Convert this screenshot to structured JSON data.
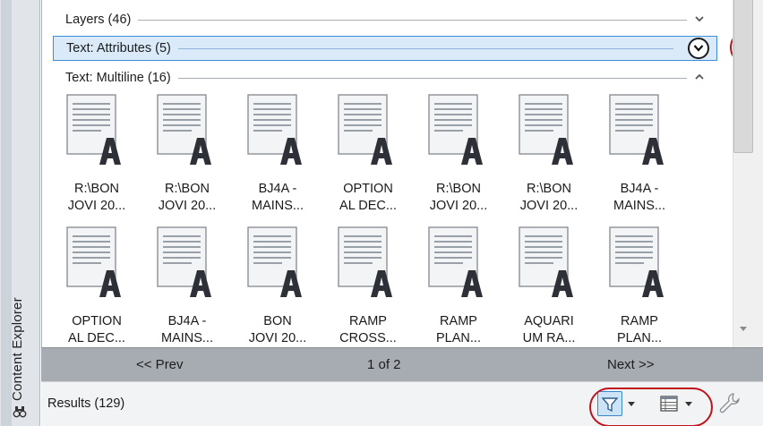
{
  "sidebar": {
    "title": "Content Explorer",
    "icon": "binoculars-icon"
  },
  "categories": [
    {
      "label": "Layers (46)",
      "chevron": "chevron-down-icon"
    },
    {
      "label": "Text: Attributes (5)",
      "chevron": "circle-chevron-down-icon",
      "selected": true
    },
    {
      "label": "Text: Multiline (16)",
      "chevron": "chevron-up-icon"
    }
  ],
  "items": [
    {
      "line1": "R:\\BON",
      "line2": "JOVI 20..."
    },
    {
      "line1": "R:\\BON",
      "line2": "JOVI 20..."
    },
    {
      "line1": "BJ4A -",
      "line2": "MAINS..."
    },
    {
      "line1": "OPTION",
      "line2": "AL DEC..."
    },
    {
      "line1": "R:\\BON",
      "line2": "JOVI 20..."
    },
    {
      "line1": "R:\\BON",
      "line2": "JOVI 20..."
    },
    {
      "line1": "BJ4A -",
      "line2": "MAINS..."
    },
    {
      "line1": "OPTION",
      "line2": "AL DEC..."
    },
    {
      "line1": "BJ4A -",
      "line2": "MAINS..."
    },
    {
      "line1": "BON",
      "line2": "JOVI 20..."
    },
    {
      "line1": "RAMP",
      "line2": "CROSS..."
    },
    {
      "line1": "RAMP",
      "line2": "PLAN..."
    },
    {
      "line1": "AQUARI",
      "line2": "UM RA..."
    },
    {
      "line1": "RAMP",
      "line2": "PLAN..."
    }
  ],
  "item_icon": "mtext-document-icon",
  "pager": {
    "prev_label": "<< Prev",
    "page_indicator": "1 of 2",
    "next_label": "Next >>"
  },
  "status": {
    "results_label": "Results (129)",
    "filter_icon": "filter-icon",
    "view_icon": "table-view-icon",
    "settings_icon": "wrench-icon"
  },
  "colors": {
    "selected_row_bg": "#dbeaf8",
    "selected_row_border": "#3c8fd6",
    "highlight_ring": "#c0121b",
    "pager_bg": "#a7acb2",
    "sidebar_bg": "#e1e5ea"
  }
}
